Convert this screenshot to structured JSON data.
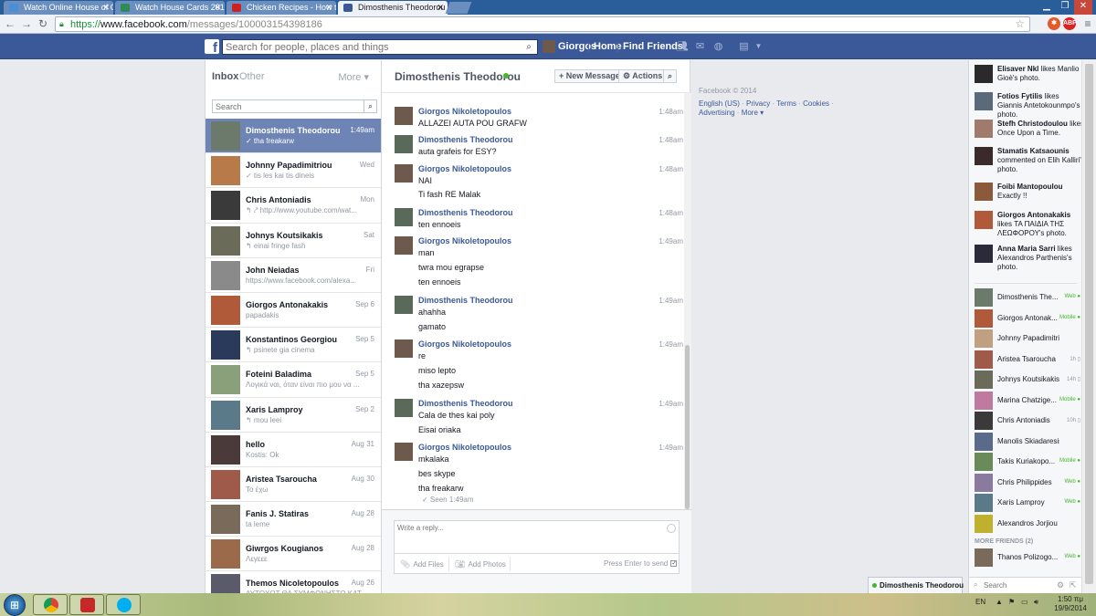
{
  "browser": {
    "tabs": [
      {
        "title": "Watch Online House of C",
        "color": "#4a8fd6"
      },
      {
        "title": "Watch House Cards 2013",
        "color": "#2e8b57"
      },
      {
        "title": "Chicken Recipes - How to",
        "color": "#cc2222"
      },
      {
        "title": "Dimosthenis Theodorou -",
        "color": "#3b5998"
      }
    ],
    "url_scheme": "https://",
    "url_host": "www.facebook.com",
    "url_path": "/messages/100003154398186"
  },
  "fb": {
    "search_placeholder": "Search for people, places and things",
    "user_name": "Giorgos",
    "nav_home": "Home",
    "nav_find_friends": "Find Friends"
  },
  "inbox": {
    "tab_inbox": "Inbox",
    "tab_other": "Other",
    "more_label": "More ▾",
    "search_placeholder": "Search",
    "threads": [
      {
        "name": "Dimosthenis Theodorou",
        "snippet": "✓ tha freakarw",
        "time": "1:49am",
        "color": "#6b7a6a"
      },
      {
        "name": "Johnny Papadimitriou",
        "snippet": "✓ tis les kai tis dineis",
        "time": "Wed",
        "color": "#b97a4a"
      },
      {
        "name": "Chris Antoniadis",
        "snippet": "↰ ⤤ http://www.youtube.com/wat...",
        "time": "Mon",
        "color": "#3a3a3a"
      },
      {
        "name": "Johnys Koutsikakis",
        "snippet": "↰ einai fringe fash",
        "time": "Sat",
        "color": "#6b6b5a"
      },
      {
        "name": "John Neiadas",
        "snippet": "https://www.facebook.com/alexa...",
        "time": "Fri",
        "color": "#8a8a8a"
      },
      {
        "name": "Giorgos Antonakakis",
        "snippet": "papadakis",
        "time": "Sep 6",
        "color": "#b05a3a"
      },
      {
        "name": "Konstantinos Georgiou",
        "snippet": "↰ psinete gia cinema",
        "time": "Sep 5",
        "color": "#2a3a5a"
      },
      {
        "name": "Foteini Baladima",
        "snippet": "Λογικά ναι, όταν είναι πιο μου να ...",
        "time": "Sep 5",
        "color": "#8aa07a"
      },
      {
        "name": "Xaris Lamproy",
        "snippet": "↰ mou leei",
        "time": "Sep 2",
        "color": "#5a7a8a"
      },
      {
        "name": "hello",
        "snippet": "Kostis: Ok",
        "time": "Aug 31",
        "color": "#4a3a3a"
      },
      {
        "name": "Aristea Tsaroucha",
        "snippet": "Το έχω",
        "time": "Aug 30",
        "color": "#a05a4a"
      },
      {
        "name": "Fanis J. Statiras",
        "snippet": "ta leme",
        "time": "Aug 28",
        "color": "#7a6a5a"
      },
      {
        "name": "Giwrgos Kougianos",
        "snippet": "Λεγεεε",
        "time": "Aug 28",
        "color": "#9a6a4a"
      },
      {
        "name": "Themos Nicoletopoulos",
        "snippet": "ΑΥΤΟΧΟΤ ΘΑ ΣΥΜΦΩΝΗΣΤΟ ΚΑΤ...",
        "time": "Aug 26",
        "color": "#5a5a6a"
      }
    ]
  },
  "conversation": {
    "name": "Dimosthenis Theodorou",
    "new_message": "+ New Message",
    "actions": "⚙ Actions",
    "messages": [
      {
        "sender": "Giorgos Nikoletopoulos",
        "time": "1:48am",
        "lines": [
          "ALLAZEI AUTA POU GRAFW"
        ],
        "color": "#6d5a4d"
      },
      {
        "sender": "Dimosthenis Theodorou",
        "time": "1:48am",
        "lines": [
          "auta grafeis for ESY?"
        ],
        "color": "#5a6a5a"
      },
      {
        "sender": "Giorgos Nikoletopoulos",
        "time": "1:48am",
        "lines": [
          "NAI",
          "Ti fash RE Malak"
        ],
        "color": "#6d5a4d"
      },
      {
        "sender": "Dimosthenis Theodorou",
        "time": "1:48am",
        "lines": [
          "ten ennoeis"
        ],
        "color": "#5a6a5a"
      },
      {
        "sender": "Giorgos Nikoletopoulos",
        "time": "1:49am",
        "lines": [
          "man",
          "twra mou egrapse",
          "ten ennoeis"
        ],
        "color": "#6d5a4d"
      },
      {
        "sender": "Dimosthenis Theodorou",
        "time": "1:49am",
        "lines": [
          "ahahha",
          "gamato"
        ],
        "color": "#5a6a5a"
      },
      {
        "sender": "Giorgos Nikoletopoulos",
        "time": "1:49am",
        "lines": [
          "re",
          "miso lepto",
          "tha xazepsw"
        ],
        "color": "#6d5a4d"
      },
      {
        "sender": "Dimosthenis Theodorou",
        "time": "1:49am",
        "lines": [
          "Cala de thes kai poly",
          "Eisai oriaka"
        ],
        "color": "#5a6a5a"
      },
      {
        "sender": "Giorgos Nikoletopoulos",
        "time": "1:49am",
        "lines": [
          "mkalaka",
          "bes skype",
          "tha freakarw"
        ],
        "color": "#6d5a4d"
      }
    ],
    "seen": "✓ Seen 1:49am",
    "reply_placeholder": "Write a reply...",
    "add_files": "Add Files",
    "add_photos": "Add Photos",
    "press_enter": "Press Enter to send"
  },
  "footer": {
    "copyright": "Facebook © 2014",
    "english": "English (US)",
    "privacy": "Privacy",
    "terms": "Terms",
    "cookies": "Cookies",
    "advertising": "Advertising",
    "more": "More ▾"
  },
  "ticker": [
    {
      "name": "Elisaver Nkl",
      "action": " likes Manlio Gioè's photo.",
      "color": "#2a2a2a"
    },
    {
      "name": "Fotios Fytilis",
      "action": " likes Giannis Antetokounmpo's photo.",
      "color": "#5a6a7a"
    },
    {
      "name": "Stefh Christodoulou",
      "action": " likes Once Upon a Time.",
      "color": "#a07a6a"
    },
    {
      "name": "Stamatis Katsaounis",
      "action": " commented on Elih Kalliri's photo.",
      "color": "#3a2a2a"
    },
    {
      "name": "Foibi Mantopoulou",
      "action": " Exactly !!",
      "color": "#8a5a3a"
    },
    {
      "name": "Giorgos Antonakakis",
      "action": " likes ΤΑ ΠΑΙΔΙΑ ΤΗΣ ΛΕΩΦΟΡΟΥ's photo.",
      "color": "#b05a3a"
    },
    {
      "name": "Anna Maria Sarri",
      "action": " likes Alexandros Parthenis's photo.",
      "color": "#2a2a3a"
    }
  ],
  "friends": [
    {
      "name": "Dimosthenis The...",
      "status": "Web ●",
      "color": "#6b7a6a"
    },
    {
      "name": "Giorgos Antonak...",
      "status": "Mobile ●",
      "color": "#b05a3a"
    },
    {
      "name": "Johnny Papadimitriou",
      "status": "",
      "color": "#c0a080"
    },
    {
      "name": "Aristea Tsaroucha",
      "status": "1h ▯",
      "color": "#a05a4a"
    },
    {
      "name": "Johnys Koutsikakis",
      "status": "14h ▯",
      "color": "#6b6b5a"
    },
    {
      "name": "Marina Chatzige...",
      "status": "Mobile ●",
      "color": "#c07aa0"
    },
    {
      "name": "Chris Antoniadis",
      "status": "10h ▯",
      "color": "#3a3a3a"
    },
    {
      "name": "Manolis Skiadaresis",
      "status": "",
      "color": "#5a6a8a"
    },
    {
      "name": "Takis Kuriakopo...",
      "status": "Mobile ●",
      "color": "#6a8a5a"
    },
    {
      "name": "Chris Philippides",
      "status": "Web ●",
      "color": "#8a7aa0"
    },
    {
      "name": "Xaris Lamproy",
      "status": "Web ●",
      "color": "#5a7a8a"
    },
    {
      "name": "Alexandros Jorjiou",
      "status": "",
      "color": "#c0b030"
    }
  ],
  "more_friends": "MORE FRIENDS (2)",
  "more_friends_list": [
    {
      "name": "Thanos Polizogo...",
      "status": "Web ●",
      "color": "#7a6a5a"
    }
  ],
  "sidebar_search_placeholder": "Search",
  "chat_tab": "Dimosthenis Theodorou",
  "taskbar": {
    "lang": "EN",
    "time": "1:50 πμ",
    "date": "19/9/2014"
  }
}
